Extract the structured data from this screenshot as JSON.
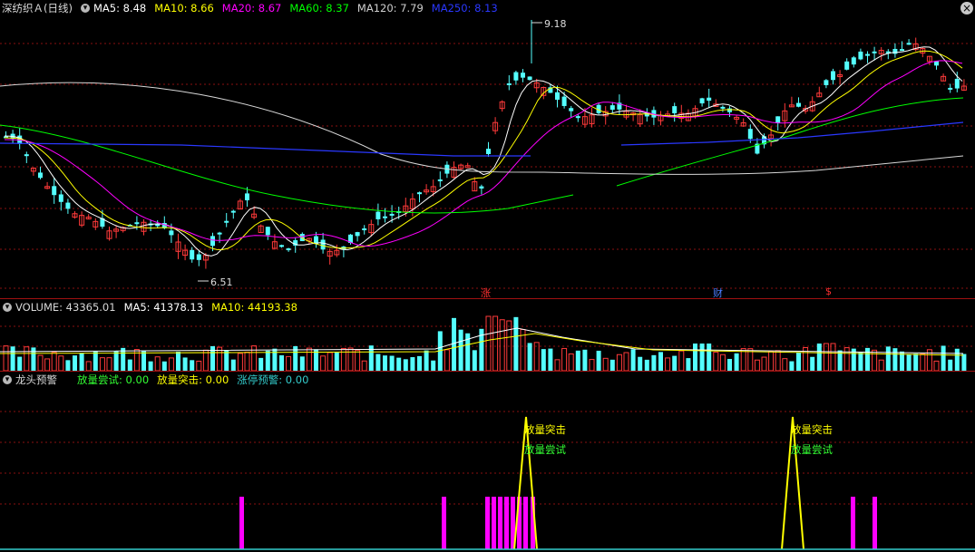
{
  "price_pane": {
    "stock_name": "深纺织Ａ(日线)",
    "collapse_icon": "chevron-down-icon",
    "ma": [
      {
        "label": "MA5: 8.48",
        "color": "#ffffff"
      },
      {
        "label": "MA10: 8.66",
        "color": "#ffff00"
      },
      {
        "label": "MA20: 8.67",
        "color": "#ff00ff"
      },
      {
        "label": "MA60: 8.37",
        "color": "#00ff00"
      },
      {
        "label": "MA120: 7.79",
        "color": "#d0d0d0"
      },
      {
        "label": "MA250: 8.13",
        "color": "#2a38ff"
      }
    ],
    "high_label": "9.18",
    "low_label": "6.51",
    "markers": [
      {
        "text": "涨",
        "color": "#ff3030"
      },
      {
        "text": "财",
        "color": "#4a7dff"
      },
      {
        "text": "$",
        "color": "#ff3030"
      }
    ],
    "close_icon": "close-icon"
  },
  "volume_pane": {
    "title": "VOLUME: 43365.01",
    "ma5": "MA5: 41378.13",
    "ma10": "MA10: 44193.38",
    "ma5_color": "#ffffff",
    "ma10_color": "#ffff00"
  },
  "indicator_pane": {
    "title": "龙头预警",
    "items": [
      {
        "label": "放量尝试: 0.00",
        "color": "#33ff33"
      },
      {
        "label": "放量突击: 0.00",
        "color": "#ffff00"
      },
      {
        "label": "涨停预警: 0.00",
        "color": "#33cccc"
      }
    ],
    "signal_labels": [
      {
        "breakout": "放量突击",
        "attempt": "放量尝试"
      },
      {
        "breakout": "放量突击",
        "attempt": "放量尝试"
      }
    ]
  },
  "colors": {
    "up": "#ff3a3a",
    "down": "#54ffff",
    "grid": "#8a1010",
    "bg": "#000000",
    "magenta": "#ff00ff"
  }
}
